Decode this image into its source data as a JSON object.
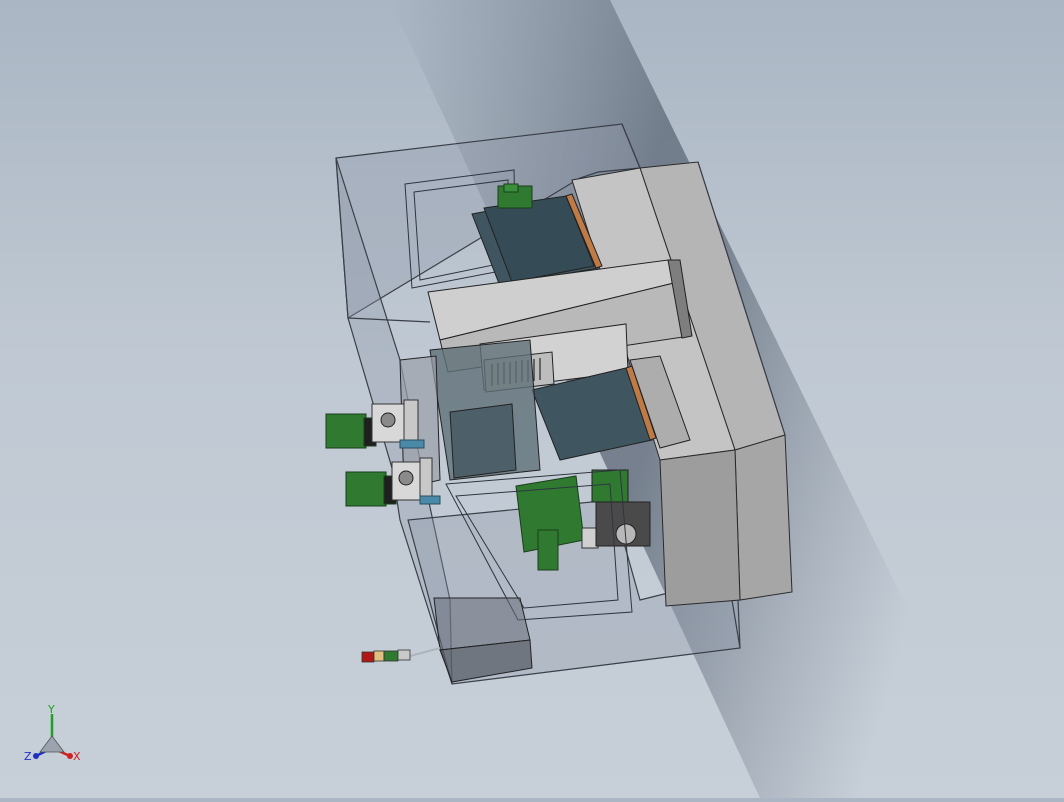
{
  "viewport": {
    "background_top": "#aab6c4",
    "background_bottom": "#c7cfd8",
    "shade_band": "#6f7a88"
  },
  "model": {
    "enclosure_color": "#8f98a8",
    "body_gray": "#b4b4b4",
    "dark_gray": "#7a7a7a",
    "teal_table": "#3f5560",
    "motor_green": "#2f7a30",
    "copper_rail": "#c07a45"
  },
  "triad": {
    "x_label": "X",
    "y_label": "Y",
    "z_label": "Z",
    "x_color": "#d02020",
    "y_color": "#20a020",
    "z_color": "#2030c0"
  }
}
